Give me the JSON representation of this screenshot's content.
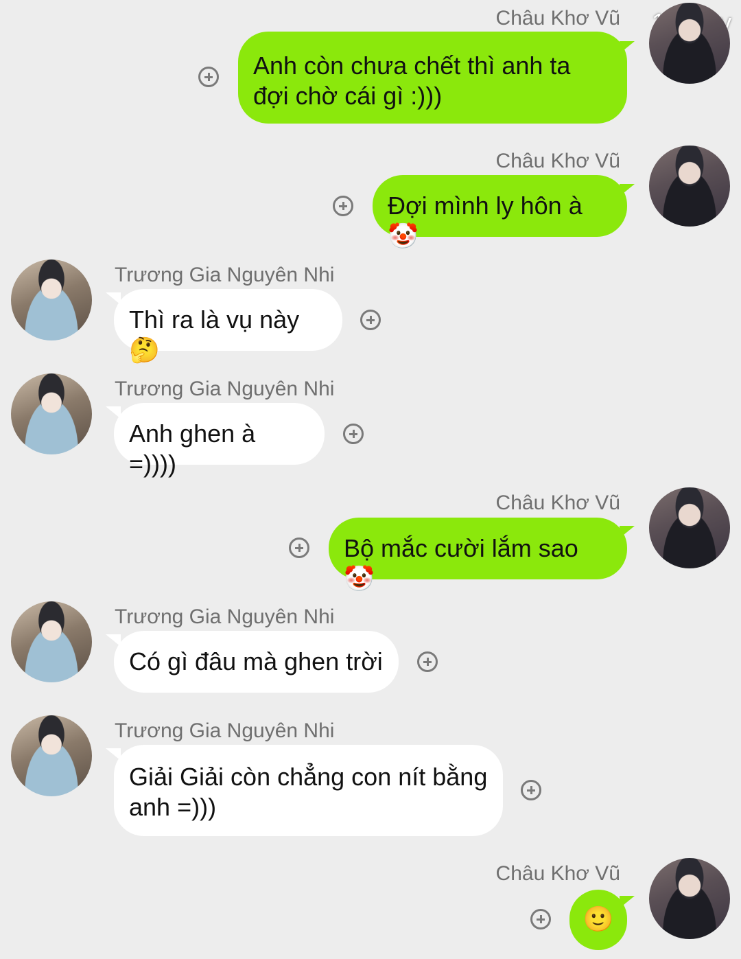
{
  "watermark": "135 joy",
  "messages": [
    {
      "sender": "Châu Khơ Vũ",
      "text": "Anh còn chưa chết thì anh ta đợi chờ cái gì :)))"
    },
    {
      "sender": "Châu Khơ Vũ",
      "text": "Đợi mình ly hôn à 🤡"
    },
    {
      "sender": "Trương Gia Nguyên Nhi",
      "text": "Thì ra là vụ này 🤔"
    },
    {
      "sender": "Trương Gia Nguyên Nhi",
      "text": "Anh ghen à =))))"
    },
    {
      "sender": "Châu Khơ Vũ",
      "text": "Bộ mắc cười lắm sao 🤡"
    },
    {
      "sender": "Trương Gia Nguyên Nhi",
      "text": "Có gì đâu mà ghen trời"
    },
    {
      "sender": "Trương Gia Nguyên Nhi",
      "text": "Giải Giải còn chẳng con nít bằng anh =)))"
    },
    {
      "sender": "Châu Khơ Vũ",
      "text": "🙂"
    }
  ],
  "colors": {
    "background": "#ededed",
    "outgoing_bubble": "#8be80c",
    "incoming_bubble": "#ffffff",
    "name_text": "#6f6f6f"
  },
  "icons": {
    "add_reaction": "plus-circle-icon",
    "avatar": "user-avatar"
  }
}
